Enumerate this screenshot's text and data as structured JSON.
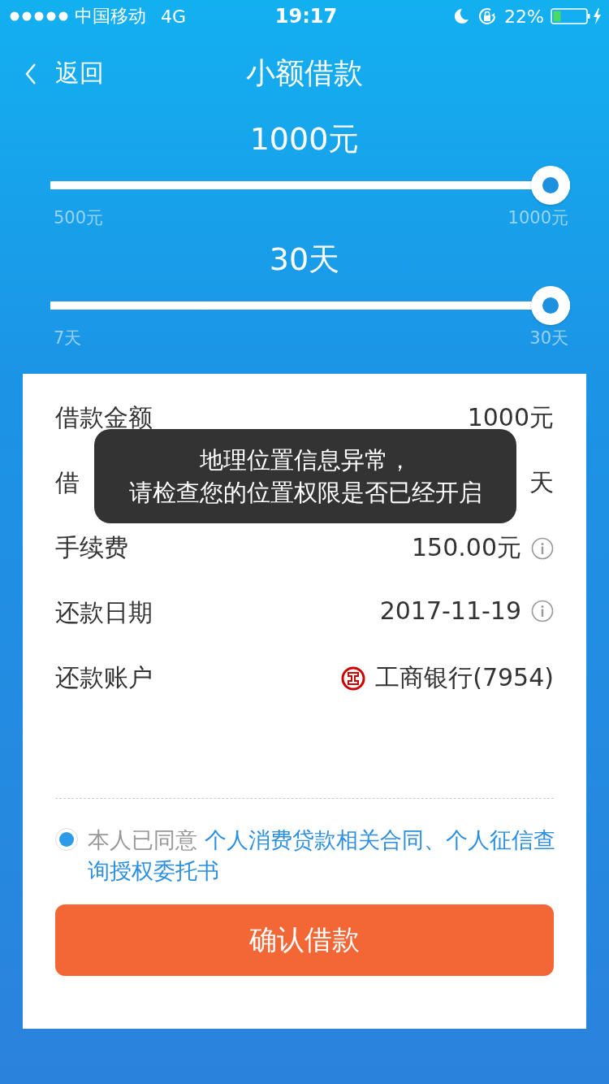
{
  "status_bar": {
    "carrier": "中国移动",
    "network": "4G",
    "time": "19:17",
    "battery": "22%"
  },
  "nav": {
    "back": "返回",
    "title": "小额借款"
  },
  "sliders": [
    {
      "value": "1000元",
      "level": 1,
      "min": "500元",
      "max": "1000元"
    },
    {
      "value": "30天",
      "level": 1,
      "min": "7天",
      "max": "30天"
    }
  ],
  "details": [
    {
      "kind": "plain",
      "label": "借款金额",
      "value": "1000元"
    },
    {
      "kind": "plain",
      "label": "借",
      "value": "天"
    },
    {
      "kind": "info",
      "label": "手续费",
      "value": "150.00元"
    },
    {
      "kind": "info",
      "label": "还款日期",
      "value": "2017-11-19"
    },
    {
      "kind": "bank",
      "label": "还款账户",
      "value": "工商银行(7954)"
    }
  ],
  "agreement": {
    "checked": true,
    "text": "本人已同意",
    "link": "个人消费贷款相关合同、个人征信查询授权委托书"
  },
  "confirm_button": "确认借款",
  "toast": [
    "地理位置信息异常，",
    "请检查您的位置权限是否已经开启"
  ]
}
